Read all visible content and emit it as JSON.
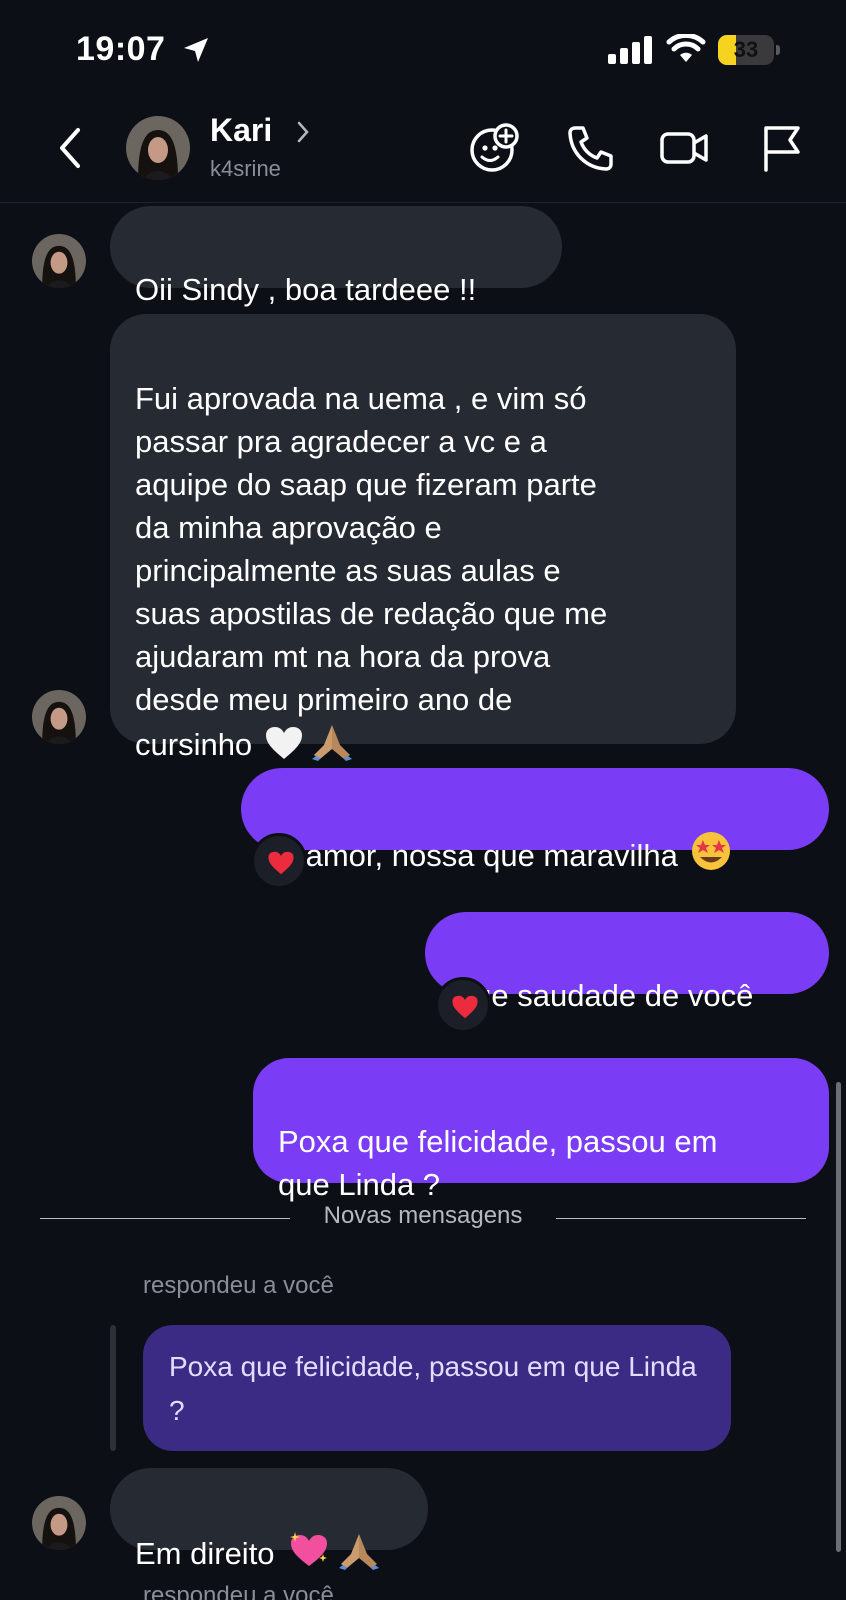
{
  "status_bar": {
    "time": "19:07",
    "battery_percent": "33",
    "battery_level": 0.33,
    "icons": [
      "location-arrow-icon",
      "cellular-signal-icon",
      "wifi-icon",
      "battery-icon"
    ]
  },
  "header": {
    "name": "Kari",
    "username": "k4srine",
    "icons": [
      "back-chevron-icon",
      "chevron-right-icon",
      "sticker-add-icon",
      "phone-icon",
      "video-call-icon",
      "flag-icon"
    ]
  },
  "messages": [
    {
      "from": "them",
      "text": "Oii Sindy , boa tardeee !!"
    },
    {
      "from": "them",
      "text": "Fui aprovada na uema , e vim só\npassar pra agradecer a  vc e a\naquipe do saap que fizeram parte\nda minha aprovação e\nprincipalmente as suas aulas e\nsuas apostilas  de redação que me\najudaram  mt na hora da prova\ndesde meu primeiro ano de\ncursinho",
      "emojis": [
        "white-heart-icon",
        "folded-hands-icon"
      ]
    },
    {
      "from": "me",
      "text": "Oi amor, nossa que maravilha",
      "emojis": [
        "star-struck-face-icon"
      ],
      "reaction": "red-heart-icon"
    },
    {
      "from": "me",
      "text": "Que saudade de você",
      "reaction": "red-heart-icon"
    },
    {
      "from": "me",
      "text": "Poxa que felicidade, passou em\nque Linda ?"
    }
  ],
  "divider": {
    "label": "Novas mensagens"
  },
  "reply": {
    "label": "respondeu a você",
    "quoted_text": "Poxa que felicidade, passou em que Linda ?",
    "message": {
      "from": "them",
      "text": "Em direito",
      "emojis": [
        "sparkling-heart-icon",
        "folded-hands-icon"
      ]
    }
  },
  "next_reply_label": "respondeu a você",
  "colors": {
    "background": "#0c0f16",
    "incoming_bubble": "#262a33",
    "outgoing_bubble": "#7a3cf5",
    "quoted_bubble": "#3b2b85",
    "battery": "#f5d31f"
  }
}
